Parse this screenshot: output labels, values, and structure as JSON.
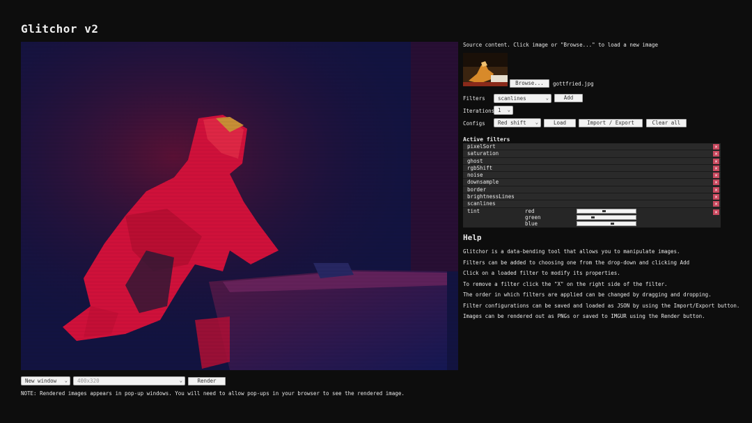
{
  "app": {
    "title": "Glitchor v2"
  },
  "canvas": {
    "icon": "processed-image"
  },
  "bottom": {
    "window_select": "New window",
    "size_select": "400x320",
    "render_label": "Render",
    "note": "NOTE: Rendered images appears in pop-up windows. You will need to allow pop-ups in your browser to see the rendered image."
  },
  "source": {
    "label": "Source content. Click image or \"Browse...\" to load a new image",
    "browse_label": "Browse...",
    "filename": "gottfried.jpg"
  },
  "filters_row": {
    "label": "Filters",
    "selected": "scanlines",
    "add_label": "Add"
  },
  "iterations_row": {
    "label": "Iterations",
    "selected": "1"
  },
  "configs_row": {
    "label": "Configs",
    "selected": "Red shift",
    "load_label": "Load",
    "import_export_label": "Import / Export",
    "clear_label": "Clear all"
  },
  "active_filters": {
    "title": "Active filters",
    "items": [
      "pixelSort",
      "saturation",
      "ghost",
      "rgbShift",
      "noise",
      "downsample",
      "border",
      "brightnessLines",
      "scanlines",
      "tint"
    ],
    "remove_glyph": "✕"
  },
  "tint": {
    "props": [
      {
        "name": "red",
        "value": 0.45
      },
      {
        "name": "green",
        "value": 0.25
      },
      {
        "name": "blue",
        "value": 0.6
      }
    ]
  },
  "help": {
    "title": "Help",
    "lines": [
      "Glitchor is a data-bending tool that allows you to manipulate images.",
      "Filters can be added to choosing one from the drop-down and clicking Add",
      "Click on a loaded filter to modify its properties.",
      "To remove a filter click the \"X\" on the right side of the filter.",
      "The order in which filters are applied can be changed by dragging and dropping.",
      "Filter configurations can be saved and loaded as JSON by using the Import/Export button.",
      "Images can be rendered out as PNGs or saved to IMGUR using the Render button."
    ]
  },
  "colors": {
    "accent_remove": "#c9485e",
    "background": "#0d0d0d"
  }
}
